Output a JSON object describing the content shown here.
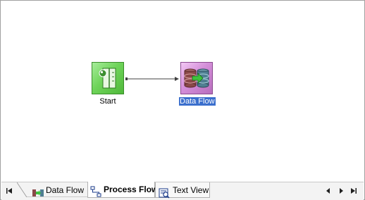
{
  "canvas": {
    "nodes": [
      {
        "label": "Start",
        "icon": "start-icon",
        "selected": false
      },
      {
        "label": "Data Flow",
        "icon": "data-flow-icon",
        "selected": true
      }
    ]
  },
  "tabs": [
    {
      "label": "Data Flow",
      "icon": "data-flow-tab-icon",
      "active": false
    },
    {
      "label": "Process Flow",
      "icon": "process-flow-tab-icon",
      "active": true
    },
    {
      "label": "Text View",
      "icon": "text-view-tab-icon",
      "active": false
    }
  ],
  "nav": {
    "first": "first-tab-icon",
    "prev": "previous-tab-icon",
    "next": "next-tab-icon",
    "last": "last-tab-icon"
  },
  "colors": {
    "start_node": "#6fd45a",
    "dataflow_node": "#d48fd9",
    "selection": "#3b6fcd"
  }
}
